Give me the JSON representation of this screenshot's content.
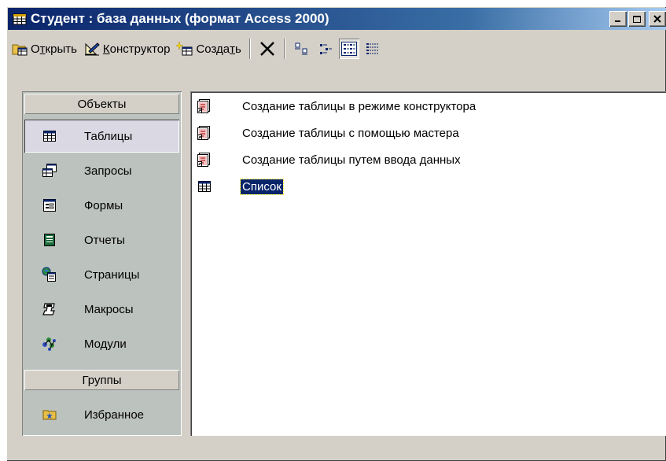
{
  "window": {
    "title": "Студент : база данных (формат Access 2000)"
  },
  "toolbar": {
    "open_label": "Открыть",
    "open_prefix": "О",
    "open_accel": "т",
    "open_rest": "крыть",
    "design_accel": "К",
    "design_rest": "онструктор",
    "create_rest": "Созда",
    "create_accel": "т",
    "create_end": "ь"
  },
  "sidebar": {
    "objects_header": "Объекты",
    "groups_header": "Группы",
    "items": [
      {
        "label": "Таблицы",
        "icon": "table-icon"
      },
      {
        "label": "Запросы",
        "icon": "query-icon"
      },
      {
        "label": "Формы",
        "icon": "form-icon"
      },
      {
        "label": "Отчеты",
        "icon": "report-icon"
      },
      {
        "label": "Страницы",
        "icon": "page-icon"
      },
      {
        "label": "Макросы",
        "icon": "macro-icon"
      },
      {
        "label": "Модули",
        "icon": "module-icon"
      }
    ],
    "groups": [
      {
        "label": "Избранное",
        "icon": "favorites-icon"
      }
    ],
    "selected": "Таблицы"
  },
  "list": {
    "items": [
      {
        "label": "Создание таблицы в режиме конструктора",
        "icon": "shortcut-icon"
      },
      {
        "label": "Создание таблицы с помощью мастера",
        "icon": "shortcut-icon"
      },
      {
        "label": "Создание таблицы путем ввода данных",
        "icon": "shortcut-icon"
      },
      {
        "label": "Список",
        "icon": "table-icon"
      }
    ],
    "selected": "Список"
  },
  "colors": {
    "title_gradient_start": "#0a246a",
    "title_gradient_end": "#a6caf0",
    "face": "#d4d0c8",
    "objbar": "#bcc2bd",
    "selection": "#0a246a"
  }
}
